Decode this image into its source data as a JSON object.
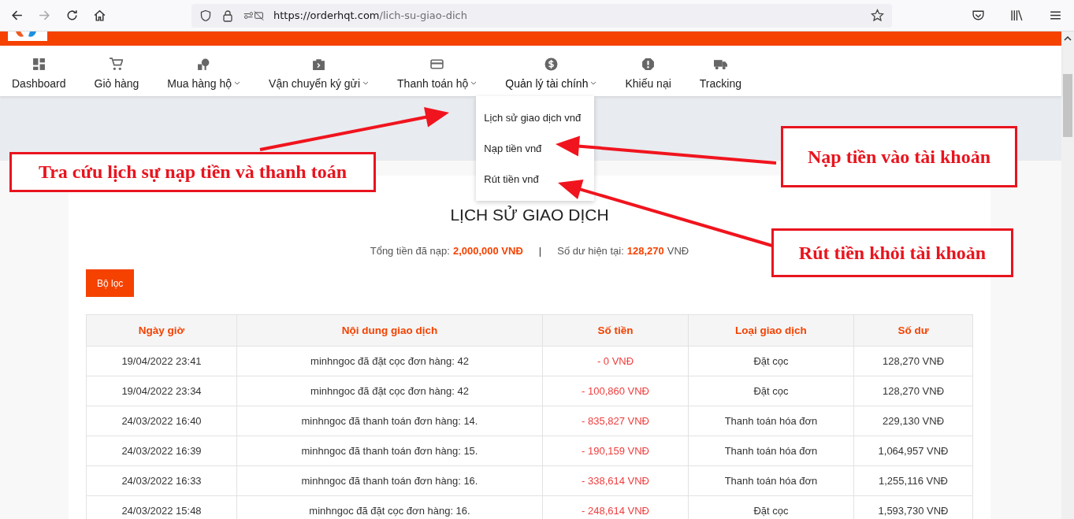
{
  "browser": {
    "url_host": "https://orderhqt.com",
    "url_path": "/lich-su-giao-dich"
  },
  "nav": [
    {
      "label": "Dashboard",
      "kind": "link",
      "expanded": false
    },
    {
      "label": "Giỏ hàng",
      "kind": "link",
      "expanded": false
    },
    {
      "label": "Mua hàng hộ",
      "kind": "dropdown",
      "expanded": false
    },
    {
      "label": "Vận chuyển ký gửi",
      "kind": "dropdown",
      "expanded": false
    },
    {
      "label": "Thanh toán hộ",
      "kind": "dropdown",
      "expanded": false
    },
    {
      "label": "Quản lý tài chính",
      "kind": "dropdown",
      "expanded": true,
      "menu": [
        "Lịch sử giao dịch vnđ",
        "Nạp tiền vnđ",
        "Rút tiền vnđ"
      ]
    },
    {
      "label": "Khiếu nại",
      "kind": "link",
      "expanded": false
    },
    {
      "label": "Tracking",
      "kind": "link",
      "expanded": false
    }
  ],
  "page_title": "LỊCH SỬ GIAO DỊCH",
  "summary": {
    "total_label": "Tổng tiền đã nạp:",
    "total_value": "2,000,000 VNĐ",
    "separator": "|",
    "balance_label": "Số dư hiện tại:",
    "balance_value": "128,270",
    "balance_unit": "VNĐ"
  },
  "filter_button": "Bộ lọc",
  "table": {
    "columns": [
      "Ngày giờ",
      "Nội dung giao dịch",
      "Số tiền",
      "Loại giao dịch",
      "Số dư"
    ],
    "rows": [
      [
        "19/04/2022 23:41",
        "minhngoc đã đặt cọc đơn hàng: 42",
        "- 0 VNĐ",
        "Đặt cọc",
        "128,270 VNĐ"
      ],
      [
        "19/04/2022 23:34",
        "minhngoc đã đặt cọc đơn hàng: 42",
        "- 100,860 VNĐ",
        "Đặt cọc",
        "128,270 VNĐ"
      ],
      [
        "24/03/2022 16:40",
        "minhngoc đã thanh toán đơn hàng: 14.",
        "- 835,827 VNĐ",
        "Thanh toán hóa đơn",
        "229,130 VNĐ"
      ],
      [
        "24/03/2022 16:39",
        "minhngoc đã thanh toán đơn hàng: 15.",
        "- 190,159 VNĐ",
        "Thanh toán hóa đơn",
        "1,064,957 VNĐ"
      ],
      [
        "24/03/2022 16:33",
        "minhngoc đã thanh toán đơn hàng: 16.",
        "- 338,614 VNĐ",
        "Thanh toán hóa đơn",
        "1,255,116 VNĐ"
      ],
      [
        "24/03/2022 15:48",
        "minhngoc đã đặt cọc đơn hàng: 16.",
        "- 248,614 VNĐ",
        "Đặt cọc",
        "1,593,730 VNĐ"
      ]
    ]
  },
  "annotations": [
    "Tra cứu lịch sự nạp tiền và thanh toán",
    "Nạp tiền vào tài khoản",
    "Rút tiền khỏi tài khoản"
  ]
}
